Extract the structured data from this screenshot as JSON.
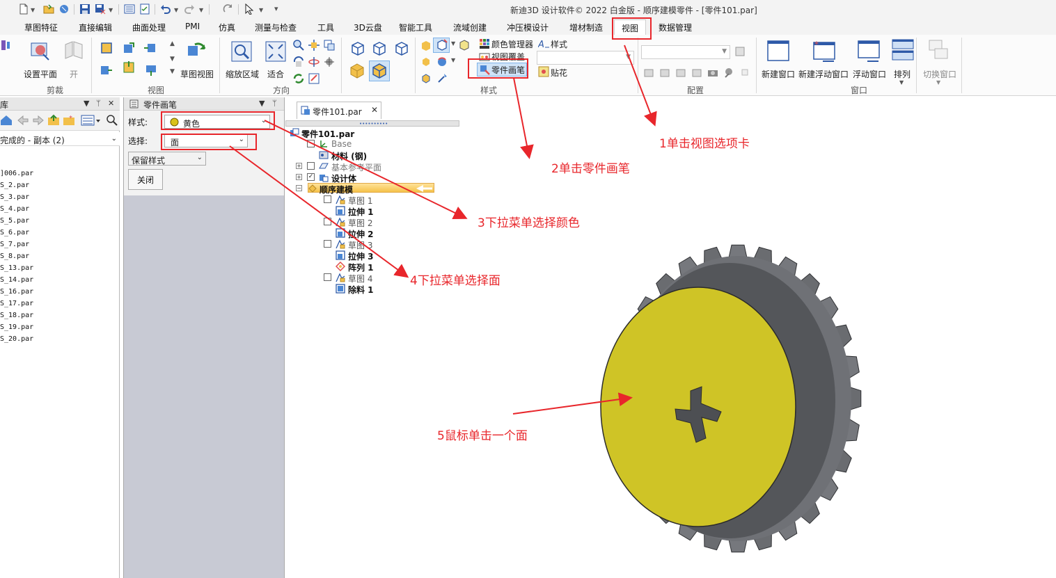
{
  "window": {
    "title": "新迪3D 设计软件© 2022 白金版 - 顺序建模零件 - [零件101.par]"
  },
  "tabs": [
    {
      "label": "草图特征"
    },
    {
      "label": "直接编辑"
    },
    {
      "label": "曲面处理"
    },
    {
      "label": "PMI"
    },
    {
      "label": "仿真"
    },
    {
      "label": "测量与检查"
    },
    {
      "label": "工具"
    },
    {
      "label": "3D云盘"
    },
    {
      "label": "智能工具"
    },
    {
      "label": "流域创建"
    },
    {
      "label": "冲压模设计"
    },
    {
      "label": "增材制造"
    },
    {
      "label": "视图"
    },
    {
      "label": "数据管理"
    }
  ],
  "ribbon": {
    "clip": {
      "set_plane": "设置平面",
      "open": "开",
      "group": "剪裁"
    },
    "view": {
      "sketch_view": "草图视图",
      "group": "视图"
    },
    "orient": {
      "zoom_area": "缩放区域",
      "fit": "适合",
      "group": "方向"
    },
    "style": {
      "color_manager": "颜色管理器",
      "view_override": "视图覆盖",
      "part_painter": "零件画笔",
      "style_btn": "样式",
      "decal": "贴花",
      "group": "样式"
    },
    "config": {
      "group": "配置"
    },
    "window": {
      "new_window": "新建窗口",
      "new_float_window": "新建浮动窗口",
      "float_window": "浮动窗口",
      "arrange": "排列",
      "switch_window": "切换窗口",
      "group": "窗口"
    }
  },
  "library": {
    "header": "库",
    "folder": "完成的 - 副本 (2)",
    "files": [
      "]006.par",
      "S_2.par",
      "S_3.par",
      "S_4.par",
      "S_5.par",
      "S_6.par",
      "S_7.par",
      "S_8.par",
      "S_13.par",
      "S_14.par",
      "S_16.par",
      "S_17.par",
      "S_18.par",
      "S_19.par",
      "S_20.par"
    ]
  },
  "painter": {
    "header": "零件画笔",
    "style_label": "样式:",
    "style_value": "黄色",
    "select_label": "选择:",
    "select_value": "面",
    "keep_style": "保留样式",
    "close": "关闭"
  },
  "document": {
    "tab": "零件101.par",
    "tree": {
      "root": "零件101.par",
      "base": "Base",
      "material": "材料 (钢)",
      "ref_planes": "基本参考平面",
      "design_body": "设计体",
      "seq_model": "顺序建模",
      "features": [
        "草图 1",
        "拉伸 1",
        "草图 2",
        "拉伸 2",
        "草图 3",
        "拉伸 3",
        "阵列 1",
        "草图 4",
        "除料 1"
      ]
    }
  },
  "annotations": {
    "a1": "1单击视图选项卡",
    "a2": "2单击零件画笔",
    "a3": "3下拉菜单选择颜色",
    "a4": "4下拉菜单选择面",
    "a5": "5鼠标单击一个面"
  },
  "colors": {
    "annotation": "#e8262b",
    "face_yellow": "#cfc426",
    "gear_gray": "#6d6f73"
  }
}
